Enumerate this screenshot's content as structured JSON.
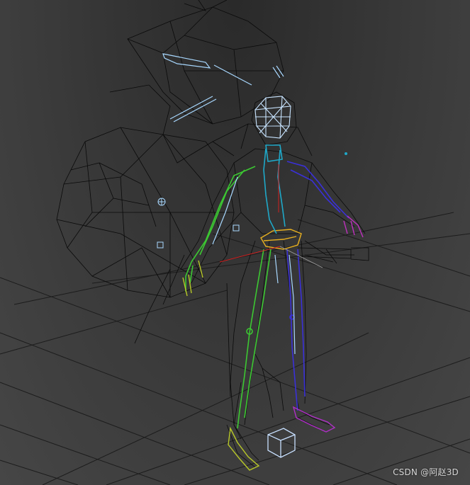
{
  "viewport": {
    "background_top": "#2a2a2a",
    "background_bottom": "#464646"
  },
  "colors": {
    "grid": "#1c1c1c",
    "wire": "#0a0a0a",
    "left_chain": "#3cc832",
    "right_chain": "#3a30d8",
    "spine": "#1fa8c8",
    "bone_light": "#a8d8ff",
    "head": "#c8e4ff",
    "pelvis": "#e8b020",
    "foot_left": "#b8c828",
    "foot_right": "#b030c8",
    "hand_right": "#c030c0",
    "helper_box": "#c8e0ff",
    "axis_red": "#d02020"
  },
  "watermark": {
    "text": "CSDN @阿赵3D"
  }
}
